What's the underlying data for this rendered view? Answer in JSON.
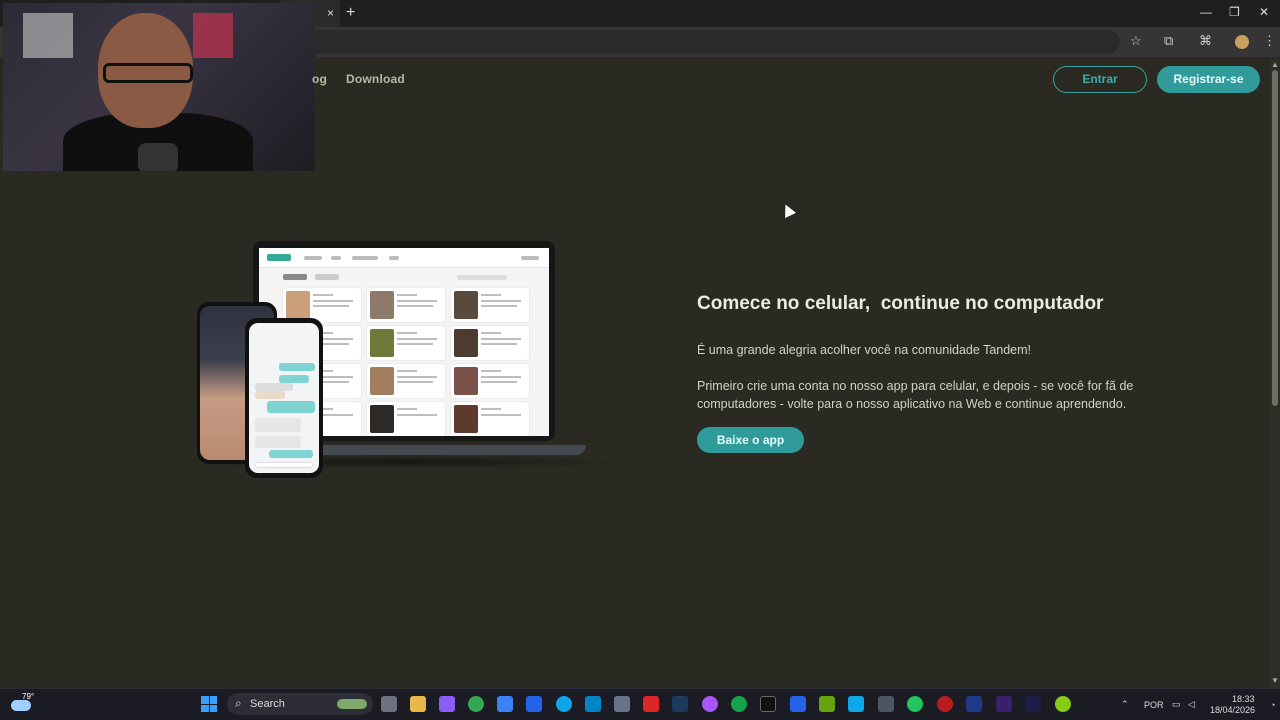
{
  "browser": {
    "tab_close": "×",
    "new_tab": "+",
    "window_controls": {
      "minimize": "—",
      "restore": "❐",
      "close": "✕"
    },
    "toolbar_icons": [
      "star-icon",
      "extension-icon",
      "puzzle-icon",
      "profile-avatar",
      "menu-icon"
    ]
  },
  "nav": {
    "blog_partial": "og",
    "download": "Download",
    "login": "Entrar",
    "register": "Registrar-se"
  },
  "hero": {
    "title": "Comece no celular,  continue no computador",
    "p1": "É uma grande alegria acolher você na comunidade Tandem!",
    "p2": "Primeiro crie uma conta no nosso app para celular, e depois - se você for fã de computadores - volte para o nosso aplicativo na Web e continue aprendendo.",
    "cta": "Baixe o app"
  },
  "illustration": {
    "laptop_brand": "tandem"
  },
  "taskbar": {
    "weather_temp": "79°",
    "search_label": "Search",
    "language": "POR",
    "time": "18:33",
    "date": "18/04/2026"
  },
  "colors": {
    "page_bg": "#2a2a22",
    "accent": "#2f9b9b",
    "text_light": "#ecebe2"
  }
}
